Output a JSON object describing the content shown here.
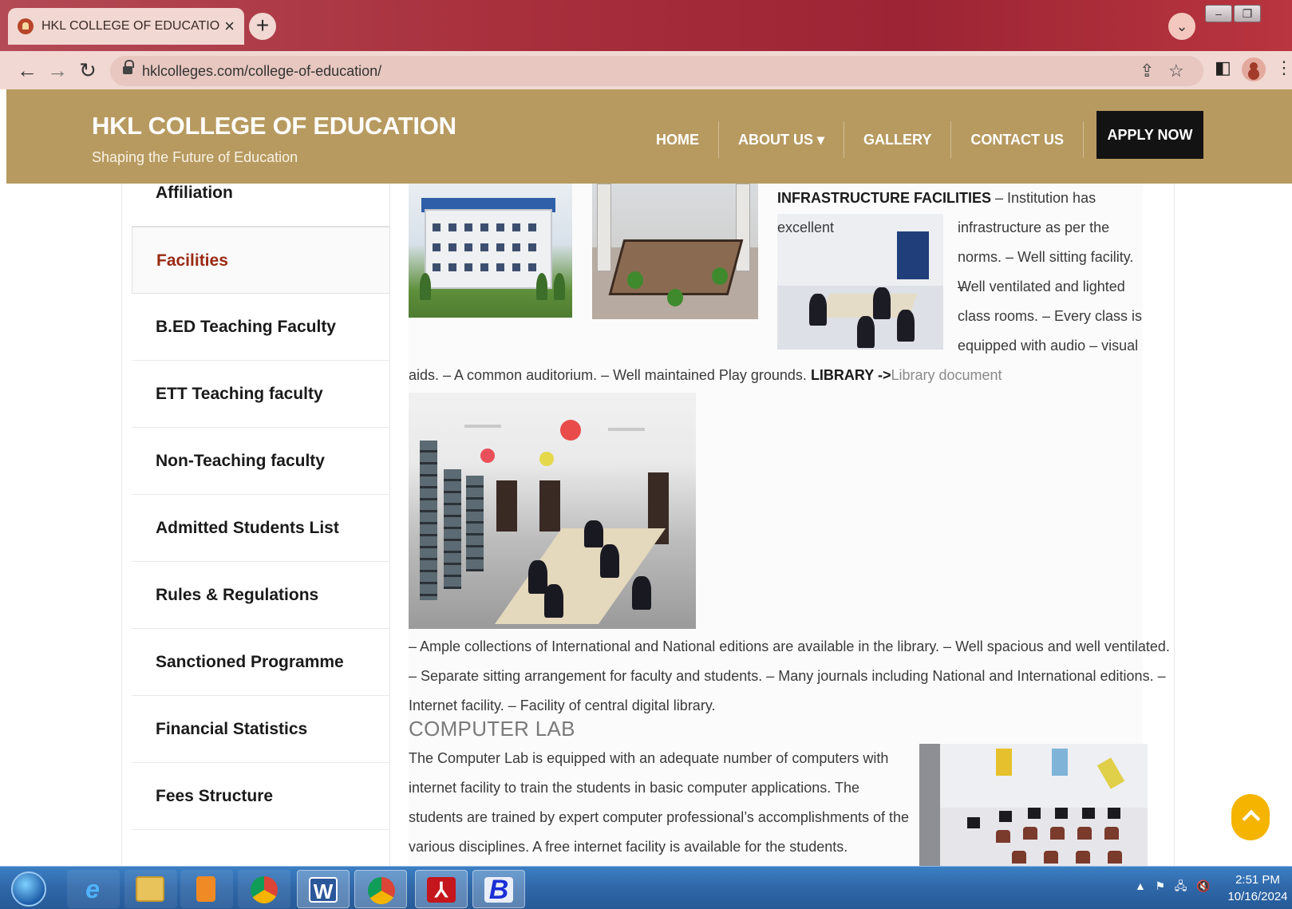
{
  "browser": {
    "tab_title": "HKL COLLEGE OF EDUCATION – ",
    "tab_close": "×",
    "new_tab": "+",
    "url": "hklcolleges.com/college-of-education/"
  },
  "site": {
    "logo": "HKL COLLEGE OF EDUCATION",
    "tagline": "Shaping the Future of Education",
    "nav": {
      "home": "HOME",
      "about": "ABOUT US ▾",
      "gallery": "GALLERY",
      "contact": "CONTACT US",
      "apply": "APPLY NOW"
    },
    "brand_color": "#b79a60"
  },
  "sidebar": {
    "items": [
      {
        "label": "Affiliation",
        "active": false
      },
      {
        "label": "Facilities",
        "active": true
      },
      {
        "label": "B.ED Teaching Faculty",
        "active": false
      },
      {
        "label": "ETT Teaching faculty",
        "active": false
      },
      {
        "label": "Non-Teaching faculty",
        "active": false
      },
      {
        "label": "Admitted Students List",
        "active": false
      },
      {
        "label": "Rules & Regulations",
        "active": false
      },
      {
        "label": "Sanctioned Programme",
        "active": false
      },
      {
        "label": "Financial Statistics",
        "active": false
      },
      {
        "label": "Fees Structure",
        "active": false
      }
    ],
    "active_color": "#9a2a14"
  },
  "content": {
    "infra_heading": "INFRASTRUCTURE FACILITIES",
    "infra_text_1": " – Institution has excellent",
    "infra_line_2": "infrastructure as per the",
    "infra_line_3": "norms. – Well sitting facility. –",
    "infra_line_4": "Well ventilated and lighted",
    "infra_line_5": "class rooms. – Every class is",
    "infra_line_6": "equipped with audio – visual",
    "infra_line_7": "aids. – A common auditorium. – Well maintained Play grounds. ",
    "library_label": "LIBRARY ->",
    "library_link": "Library document",
    "library_line_1": "– Ample collections of International and National editions are available in the library. – Well spacious and well ventilated.",
    "library_line_2": "– Separate sitting arrangement for faculty and students. – Many journals including National and International editions. –",
    "library_line_3": "Internet facility. – Facility of central digital library.",
    "computer_title": "COMPUTER LAB",
    "computer_line_1": "The Computer Lab is equipped with an adequate number of computers with",
    "computer_line_2": "internet facility to train the students in basic computer applications. The",
    "computer_line_3": "students are trained by expert computer professional’s accomplishments of the",
    "computer_line_4": "various disciplines. A free internet facility is available for the students."
  },
  "taskbar": {
    "word_glyph": "W",
    "b_glyph": "B",
    "time": "2:51 PM",
    "date": "10/16/2024"
  }
}
